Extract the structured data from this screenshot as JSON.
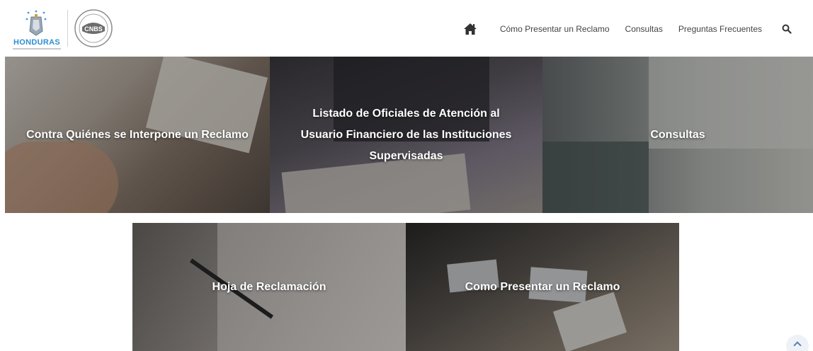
{
  "header": {
    "logo_text": "HONDURAS",
    "logo_cnbs_text": "CNBS",
    "nav": {
      "home_icon": "home-icon",
      "items": [
        {
          "label": "Cómo Presentar un Reclamo"
        },
        {
          "label": "Consultas"
        },
        {
          "label": "Preguntas Frecuentes"
        }
      ],
      "search_icon": "search-icon"
    }
  },
  "tiles": [
    {
      "label": "Contra Quiénes se Interpone un Reclamo"
    },
    {
      "label": "Listado de Oficiales de Atención al Usuario Financiero de las Instituciones Supervisadas"
    },
    {
      "label": "Consultas"
    },
    {
      "label": "Hoja de Reclamación"
    },
    {
      "label": "Como Presentar un Reclamo"
    }
  ],
  "scroll_top_icon": "chevron-up-icon",
  "colors": {
    "brand_blue": "#2e8fcf",
    "nav_text": "#444444",
    "tile_text": "#ffffff"
  }
}
